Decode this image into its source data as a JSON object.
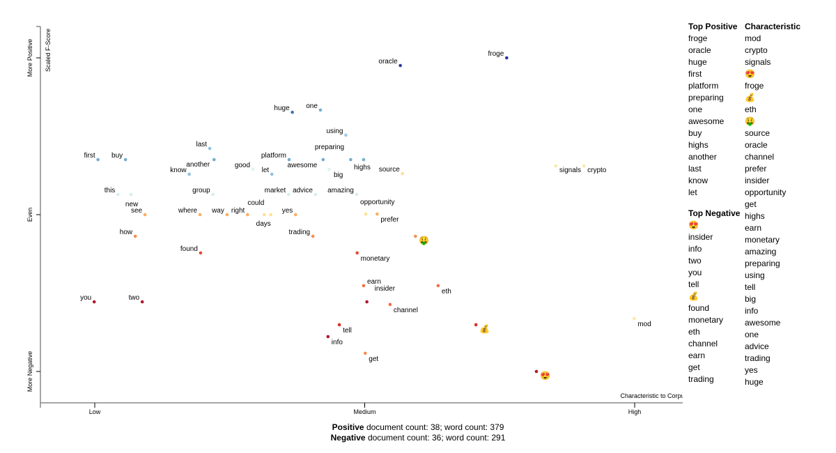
{
  "chart_data": {
    "type": "scatter",
    "title": "",
    "xlabel": "Characteristic to Corpus",
    "ylabel": "Scaled F-Score",
    "x_ticks": [
      {
        "value": 0,
        "label": "Low"
      },
      {
        "value": 0.5,
        "label": "Medium"
      },
      {
        "value": 1,
        "label": "High"
      }
    ],
    "y_ticks": [
      {
        "value": 1,
        "label": "More Positive"
      },
      {
        "value": 0,
        "label": "Even"
      },
      {
        "value": -1,
        "label": "More Negative"
      }
    ],
    "xlim": [
      -0.1,
      1.1
    ],
    "ylim": [
      -1.19,
      1.2
    ],
    "grid": false,
    "points": [
      {
        "term": "froge",
        "x": 0.763,
        "y": 1.0,
        "color": "#313695",
        "label_pos": "left"
      },
      {
        "term": "oracle",
        "x": 0.566,
        "y": 0.951,
        "color": "#313695",
        "label_pos": "left"
      },
      {
        "term": "huge",
        "x": 0.366,
        "y": 0.653,
        "color": "#4575b4",
        "label_pos": "left"
      },
      {
        "term": "one",
        "x": 0.418,
        "y": 0.667,
        "color": "#74add1",
        "label_pos": "left"
      },
      {
        "term": "using",
        "x": 0.465,
        "y": 0.507,
        "color": "#9ecae1",
        "label_pos": "left"
      },
      {
        "term": "preparing",
        "x": 0.423,
        "y": 0.351,
        "color": "#74add1",
        "label_pos": "above"
      },
      {
        "term": "",
        "x": 0.474,
        "y": 0.351,
        "color": "#74add1",
        "label_pos": "none"
      },
      {
        "term": "highs",
        "x": 0.498,
        "y": 0.351,
        "color": "#74add1",
        "label_pos": "below"
      },
      {
        "term": "platform",
        "x": 0.36,
        "y": 0.351,
        "color": "#74add1",
        "label_pos": "left"
      },
      {
        "term": "good",
        "x": 0.293,
        "y": 0.289,
        "color": "#e0f3e8",
        "label_pos": "left"
      },
      {
        "term": "let",
        "x": 0.328,
        "y": 0.258,
        "color": "#8fc1de",
        "label_pos": "left"
      },
      {
        "term": "awesome",
        "x": 0.434,
        "y": 0.289,
        "color": "#e0f3e8",
        "label_pos": "left"
      },
      {
        "term": "big",
        "x": 0.434,
        "y": 0.289,
        "color": "#e0f3e8",
        "label_pos": "below-left"
      },
      {
        "term": "source",
        "x": 0.57,
        "y": 0.262,
        "color": "#fee090",
        "label_pos": "left"
      },
      {
        "term": "first",
        "x": 0.006,
        "y": 0.351,
        "color": "#74add1",
        "label_pos": "left"
      },
      {
        "term": "buy",
        "x": 0.057,
        "y": 0.351,
        "color": "#74add1",
        "label_pos": "left"
      },
      {
        "term": "last",
        "x": 0.213,
        "y": 0.422,
        "color": "#8fc1de",
        "label_pos": "left"
      },
      {
        "term": "another",
        "x": 0.221,
        "y": 0.351,
        "color": "#74add1",
        "label_pos": "below-left"
      },
      {
        "term": "know",
        "x": 0.175,
        "y": 0.258,
        "color": "#8fc1de",
        "label_pos": "left"
      },
      {
        "term": "signals",
        "x": 0.854,
        "y": 0.311,
        "color": "#fee8a8",
        "label_pos": "right"
      },
      {
        "term": "crypto",
        "x": 0.906,
        "y": 0.311,
        "color": "#fee8a8",
        "label_pos": "right"
      },
      {
        "term": "this",
        "x": 0.043,
        "y": 0.129,
        "color": "#d4eef0",
        "label_pos": "left"
      },
      {
        "term": "new",
        "x": 0.067,
        "y": 0.129,
        "color": "#d4eef0",
        "label_pos": "below"
      },
      {
        "term": "group",
        "x": 0.219,
        "y": 0.129,
        "color": "#d4eef0",
        "label_pos": "left"
      },
      {
        "term": "market",
        "x": 0.359,
        "y": 0.129,
        "color": "#d4eef0",
        "label_pos": "left"
      },
      {
        "term": "advice",
        "x": 0.409,
        "y": 0.129,
        "color": "#d4eef0",
        "label_pos": "left"
      },
      {
        "term": "amazing",
        "x": 0.485,
        "y": 0.129,
        "color": "#d4eef0",
        "label_pos": "left"
      },
      {
        "term": "opportunity",
        "x": 0.502,
        "y": 0.004,
        "color": "#fee090",
        "label_pos": "above"
      },
      {
        "term": "prefer",
        "x": 0.523,
        "y": 0.004,
        "color": "#fdae61",
        "label_pos": "below-right"
      },
      {
        "term": "see",
        "x": 0.093,
        "y": 0.0,
        "color": "#fdae61",
        "label_pos": "left"
      },
      {
        "term": "where",
        "x": 0.195,
        "y": 0.0,
        "color": "#fdae61",
        "label_pos": "left"
      },
      {
        "term": "way",
        "x": 0.245,
        "y": 0.0,
        "color": "#fdae61",
        "label_pos": "left"
      },
      {
        "term": "right",
        "x": 0.283,
        "y": 0.0,
        "color": "#fdae61",
        "label_pos": "left"
      },
      {
        "term": "could",
        "x": 0.314,
        "y": 0.0,
        "color": "#fee090",
        "label_pos": "above"
      },
      {
        "term": "days",
        "x": 0.326,
        "y": 0.0,
        "color": "#fee090",
        "label_pos": "below"
      },
      {
        "term": "yes",
        "x": 0.372,
        "y": 0.0,
        "color": "#fdae61",
        "label_pos": "left"
      },
      {
        "term": "how",
        "x": 0.075,
        "y": -0.138,
        "color": "#f88d52",
        "label_pos": "left"
      },
      {
        "term": "trading",
        "x": 0.404,
        "y": -0.138,
        "color": "#f88d52",
        "label_pos": "left"
      },
      {
        "term": "🤑",
        "x": 0.594,
        "y": -0.138,
        "color": "#f88d52",
        "label_pos": "emoji"
      },
      {
        "term": "found",
        "x": 0.196,
        "y": -0.244,
        "color": "#e34a33",
        "label_pos": "left"
      },
      {
        "term": "monetary",
        "x": 0.486,
        "y": -0.244,
        "color": "#e34a33",
        "label_pos": "below-right"
      },
      {
        "term": "earn",
        "x": 0.498,
        "y": -0.453,
        "color": "#f46d43",
        "label_pos": "right"
      },
      {
        "term": "insider",
        "x": 0.504,
        "y": -0.556,
        "color": "#b2182b",
        "label_pos": "above-right"
      },
      {
        "term": "eth",
        "x": 0.636,
        "y": -0.453,
        "color": "#f46d43",
        "label_pos": "below-right"
      },
      {
        "term": "channel",
        "x": 0.547,
        "y": -0.573,
        "color": "#f46d43",
        "label_pos": "below-right"
      },
      {
        "term": "you",
        "x": -0.001,
        "y": -0.556,
        "color": "#b2182b",
        "label_pos": "left"
      },
      {
        "term": "two",
        "x": 0.088,
        "y": -0.556,
        "color": "#b2182b",
        "label_pos": "left"
      },
      {
        "term": "tell",
        "x": 0.453,
        "y": -0.702,
        "color": "#d73027",
        "label_pos": "below-right"
      },
      {
        "term": "info",
        "x": 0.432,
        "y": -0.778,
        "color": "#b2182b",
        "label_pos": "below-right"
      },
      {
        "term": "get",
        "x": 0.501,
        "y": -0.884,
        "color": "#f88d52",
        "label_pos": "below-right"
      },
      {
        "term": "💰",
        "x": 0.706,
        "y": -0.702,
        "color": "#d73027",
        "label_pos": "emoji"
      },
      {
        "term": "😍",
        "x": 0.818,
        "y": -1.0,
        "color": "#b2182b",
        "label_pos": "emoji"
      },
      {
        "term": "mod",
        "x": 0.999,
        "y": -0.662,
        "color": "#fee8a8",
        "label_pos": "below-right"
      }
    ]
  },
  "lists": {
    "top_positive": {
      "header": "Top Positive",
      "items": [
        "froge",
        "oracle",
        "huge",
        "first",
        "platform",
        "preparing",
        "one",
        "awesome",
        "buy",
        "highs",
        "another",
        "last",
        "know",
        "let"
      ]
    },
    "top_negative": {
      "header": "Top Negative",
      "items": [
        "😍",
        "insider",
        "info",
        "two",
        "you",
        "tell",
        "💰",
        "found",
        "monetary",
        "eth",
        "channel",
        "earn",
        "get",
        "trading"
      ]
    },
    "characteristic": {
      "header": "Characteristic",
      "items": [
        "mod",
        "crypto",
        "signals",
        "😍",
        "froge",
        "💰",
        "eth",
        "🤑",
        "source",
        "oracle",
        "channel",
        "prefer",
        "insider",
        "opportunity",
        "get",
        "highs",
        "earn",
        "monetary",
        "amazing",
        "preparing",
        "using",
        "tell",
        "big",
        "info",
        "awesome",
        "one",
        "advice",
        "trading",
        "yes",
        "huge"
      ]
    }
  },
  "footer": {
    "positive_label": "Positive",
    "positive_text": " document count: 38; word count: 379",
    "negative_label": "Negative",
    "negative_text": " document count: 36; word count: 291"
  }
}
